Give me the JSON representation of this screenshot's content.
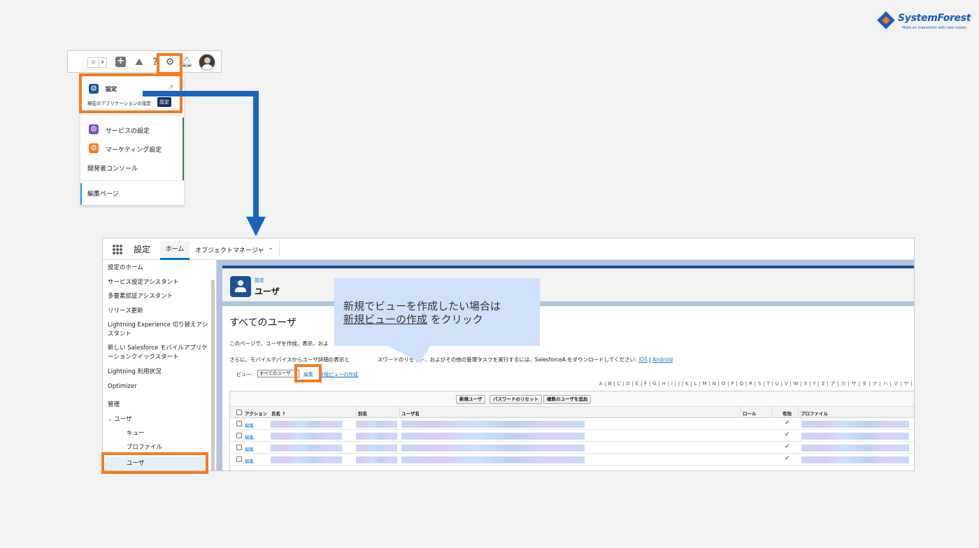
{
  "logo": {
    "text": "SystemForest",
    "tagline": "Make an impression with new values."
  },
  "header": {
    "icons": [
      "favorites-star-icon",
      "add-icon",
      "trailhead-icon",
      "help-icon",
      "setup-gear-icon",
      "notification-bell-icon",
      "avatar"
    ]
  },
  "setup_menu": {
    "setup": {
      "label": "設定",
      "sublabel": "現在のアプリケーションの設定",
      "tooltip": "設定"
    },
    "items": [
      {
        "label": "サービスの設定",
        "icon_color": "#7b4fc4"
      },
      {
        "label": "マーケティング設定",
        "icon_color": "#f47b20"
      },
      {
        "label": "開発者コンソール"
      },
      {
        "label": "編集ページ"
      }
    ],
    "setup_icon_color": "#1b5297"
  },
  "setup_app": {
    "app_name": "設定",
    "tabs": [
      "ホーム",
      "オブジェクトマネージャ"
    ],
    "sidebar": [
      "設定のホーム",
      "サービス設定アシスタント",
      "多要素認証アシスタント",
      "リリース更新",
      "Lightning Experience 切り替えアシスタント",
      "新しい Salesforce モバイルアプリケーションクイックスタート",
      "Lightning 利用状況",
      "Optimizer",
      "管理",
      "ユーザ",
      "キュー",
      "プロファイル",
      "ユーザ"
    ],
    "page_header": {
      "subtitle": "設定",
      "title": "ユーザ"
    },
    "list_title": "すべてのユーザ",
    "desc1": "このページで、ユーザを作成、表示、およ",
    "desc2_a": "さらに、モバイルデバイスからユーザ詳細の表示と",
    "desc2_b": "スワードのリセット、およびその他の管理タスクを実行するには、SalesforceA をダウンロードしてください: ",
    "ios": "iOS",
    "sep": "|",
    "android": "Android",
    "view_label": "ビュー:",
    "view_value": "すべてのユーザ",
    "edit_link": "編集",
    "new_view_link": "新規ビューの作成",
    "alphabet": "A | B | C | D | E | F | G | H | I | J | K | L | M | N | O | P | Q | R | S | T | U | V | W | X | Y | Z | ア | カ | サ | タ | ナ | ハ | マ | ヤ |",
    "buttons": [
      "新規ユーザ",
      "パスワードのリセット",
      "複数のユーザを追加"
    ],
    "columns": [
      "アクション",
      "氏名 ↑",
      "別名",
      "ユーザ名",
      "ロール",
      "有効",
      "プロファイル"
    ],
    "rows": [
      {
        "action": "編集",
        "active": "✓"
      },
      {
        "action": "編集",
        "active": "✓"
      },
      {
        "action": "編集",
        "active": "✓"
      },
      {
        "action": "編集",
        "active": "✓"
      }
    ]
  },
  "callout": {
    "line1": "新規でビューを作成したい場合は",
    "line2_link": "新規ビューの作成",
    "line2_rest": " をクリック"
  },
  "colors": {
    "highlight": "#f47b20",
    "arrow": "#1565c0",
    "brand_blue": "#1b5297",
    "callout_bg": "#cfe0f9"
  }
}
